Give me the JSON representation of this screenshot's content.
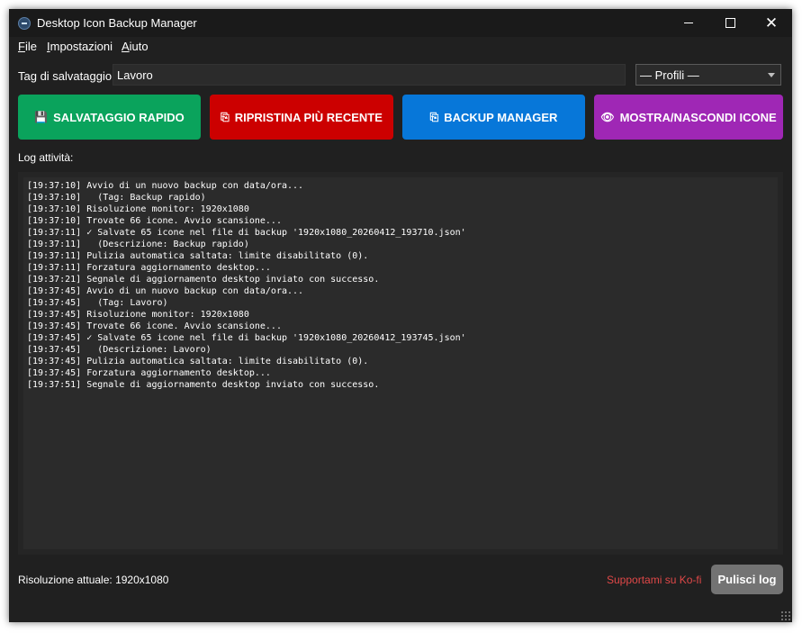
{
  "window": {
    "title": "Desktop Icon Backup Manager",
    "close_symbol": "✕"
  },
  "menu": {
    "file_u": "F",
    "file_rest": "ile",
    "settings_u": "I",
    "settings_rest": "mpostazioni",
    "help_u": "A",
    "help_rest": "iuto"
  },
  "tag": {
    "label": "Tag di salvataggio:",
    "value": "Lavoro"
  },
  "profiles": {
    "selected": "— Profili —"
  },
  "buttons": [
    {
      "label": "SALVATAGGIO RAPIDO",
      "icon": "floppy-icon",
      "glyph": "💾",
      "color": "#0aa35c"
    },
    {
      "label": "RIPRISTINA PIÙ RECENTE",
      "icon": "restore-icon",
      "glyph": "⎘",
      "color": "#cc0000"
    },
    {
      "label": "BACKUP MANAGER",
      "icon": "folder-icon",
      "glyph": "⎘",
      "color": "#0777d9"
    },
    {
      "label": "MOSTRA/NASCONDI ICONE",
      "icon": "eye-icon",
      "glyph": "👁",
      "color": "#9f27b5"
    }
  ],
  "log": {
    "label": "Log attività:",
    "lines": [
      "[19:37:10] Avvio di un nuovo backup con data/ora...",
      "[19:37:10]   (Tag: Backup rapido)",
      "[19:37:10] Risoluzione monitor: 1920x1080",
      "[19:37:10] Trovate 66 icone. Avvio scansione...",
      "[19:37:11] ✓ Salvate 65 icone nel file di backup '1920x1080_20260412_193710.json'",
      "[19:37:11]   (Descrizione: Backup rapido)",
      "[19:37:11] Pulizia automatica saltata: limite disabilitato (0).",
      "[19:37:11] Forzatura aggiornamento desktop...",
      "[19:37:21] Segnale di aggiornamento desktop inviato con successo.",
      "[19:37:45] Avvio di un nuovo backup con data/ora...",
      "[19:37:45]   (Tag: Lavoro)",
      "[19:37:45] Risoluzione monitor: 1920x1080",
      "[19:37:45] Trovate 66 icone. Avvio scansione...",
      "[19:37:45] ✓ Salvate 65 icone nel file di backup '1920x1080_20260412_193745.json'",
      "[19:37:45]   (Descrizione: Lavoro)",
      "[19:37:45] Pulizia automatica saltata: limite disabilitato (0).",
      "[19:37:45] Forzatura aggiornamento desktop...",
      "[19:37:51] Segnale di aggiornamento desktop inviato con successo."
    ]
  },
  "footer": {
    "status": "Risoluzione attuale: 1920x1080",
    "support": "Supportami su Ko-fi",
    "clear": "Pulisci log"
  },
  "colors": {
    "window_bg": "#202020",
    "titlebar_bg": "#1a1a1a",
    "log_bg": "#2b2b2b",
    "support_link": "#e04848",
    "clear_button": "#737373"
  }
}
